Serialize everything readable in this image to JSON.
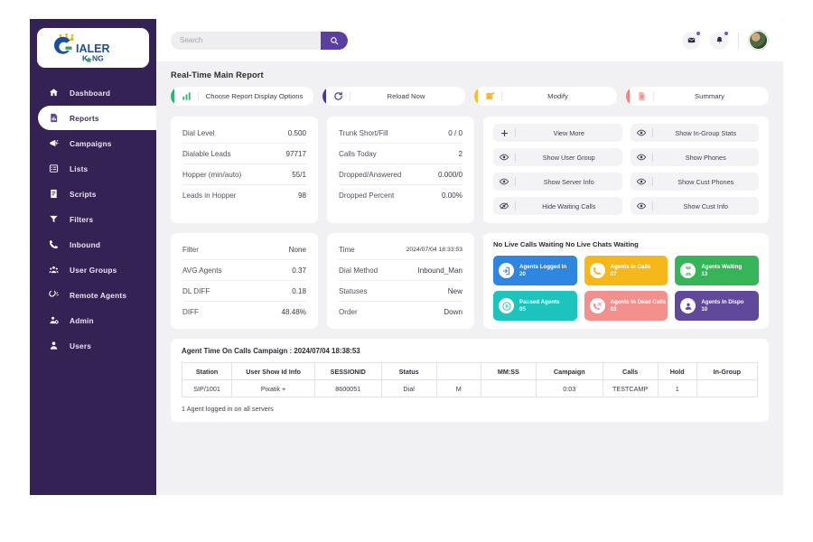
{
  "brand": {
    "name_main": "IALER",
    "name_sub": "K NG",
    "full": "DIALER KING"
  },
  "sidebar": {
    "items": [
      {
        "label": "Dashboard",
        "icon": "home-icon",
        "active": false
      },
      {
        "label": "Reports",
        "icon": "report-document-icon",
        "active": true
      },
      {
        "label": "Campaigns",
        "icon": "megaphone-icon",
        "active": false
      },
      {
        "label": "Lists",
        "icon": "list-icon",
        "active": false
      },
      {
        "label": "Scripts",
        "icon": "script-icon",
        "active": false
      },
      {
        "label": "Filters",
        "icon": "funnel-icon",
        "active": false
      },
      {
        "label": "Inbound",
        "icon": "phone-icon",
        "active": false
      },
      {
        "label": "User Groups",
        "icon": "users-group-icon",
        "active": false
      },
      {
        "label": "Remote Agents",
        "icon": "remote-agent-icon",
        "active": false
      },
      {
        "label": "Admin",
        "icon": "admin-gear-user-icon",
        "active": false
      },
      {
        "label": "Users",
        "icon": "user-icon",
        "active": false
      }
    ]
  },
  "topbar": {
    "search_placeholder": "Search",
    "search_value": "",
    "search_icon": "search-icon",
    "mail_icon": "mail-icon",
    "bell_icon": "bell-icon",
    "avatar": "user-avatar"
  },
  "page": {
    "title": "Real-Time Main Report"
  },
  "action_bar": [
    {
      "label": "Choose Report Display Options",
      "icon": "bar-chart-icon",
      "color": "#2bb673"
    },
    {
      "label": "Reload Now",
      "icon": "refresh-icon",
      "color": "#4b3a8f"
    },
    {
      "label": "Modify",
      "icon": "edit-pencil-icon",
      "color": "#f5c022"
    },
    {
      "label": "Summary",
      "icon": "document-icon",
      "color": "#f4817e"
    }
  ],
  "stats_left": [
    {
      "key": "Dial Level",
      "value": "0.500"
    },
    {
      "key": "Dialable Leads",
      "value": "97717"
    },
    {
      "key": "Hopper (min/auto)",
      "value": "55/1"
    },
    {
      "key": "Leads in Hopper",
      "value": "98"
    }
  ],
  "stats_mid": [
    {
      "key": "Trunk Short/Fill",
      "value": "0 / 0"
    },
    {
      "key": "Calls Today",
      "value": "2"
    },
    {
      "key": "Dropped/Answered",
      "value": "0.000/0"
    },
    {
      "key": "Dropped Percent",
      "value": "0.00%"
    }
  ],
  "stats_left2": [
    {
      "key": "Filter",
      "value": "None"
    },
    {
      "key": "AVG Agents",
      "value": "0.37"
    },
    {
      "key": "DL DIFF",
      "value": "0.18"
    },
    {
      "key": "DIFF",
      "value": "48.48%"
    }
  ],
  "stats_mid2": [
    {
      "key": "Time",
      "value": "2024/07/04 18:33:53",
      "small": true
    },
    {
      "key": "Dial Method",
      "value": "Inbound_Man"
    },
    {
      "key": "Statuses",
      "value": "New"
    },
    {
      "key": "Order",
      "value": "Down"
    }
  ],
  "toggles": [
    {
      "label": "View More",
      "icon": "plus-icon"
    },
    {
      "label": "Show In-Group Stats",
      "icon": "eye-icon"
    },
    {
      "label": "Show User Group",
      "icon": "eye-icon"
    },
    {
      "label": "Show Phones",
      "icon": "eye-icon"
    },
    {
      "label": "Show Server Info",
      "icon": "eye-icon"
    },
    {
      "label": "Show Cust Phones",
      "icon": "eye-icon"
    },
    {
      "label": "Hide Waiting Calls",
      "icon": "eye-off-icon"
    },
    {
      "label": "Show Cust Info",
      "icon": "eye-icon"
    }
  ],
  "agents": {
    "heading": "No Live Calls Waiting No Live Chats Waiting",
    "cards": [
      {
        "title": "Agents Logged In",
        "count": "20",
        "color": "#2f86e0",
        "icon": "agent-login-icon"
      },
      {
        "title": "Agents In Calls",
        "count": "07",
        "color": "#f5b818",
        "icon": "phone-call-icon"
      },
      {
        "title": "Agents Waiting",
        "count": "13",
        "color": "#35b558",
        "icon": "hourglass-icon"
      },
      {
        "title": "Paused Agents",
        "count": "05",
        "color": "#1dc4bd",
        "icon": "pause-icon"
      },
      {
        "title": "Agents In Dead Calls",
        "count": "02",
        "color": "#f2908e",
        "icon": "phone-missed-icon"
      },
      {
        "title": "Agents In Dispo",
        "count": "10",
        "color": "#60499b",
        "icon": "person-badge-icon"
      }
    ]
  },
  "table": {
    "title": "Agent Time On Calls Campaign : 2024/07/04 18:38:53",
    "headers": [
      "Station",
      "User Show Id Info",
      "SESSIONID",
      "Status",
      "",
      "MM:SS",
      "Campaign",
      "Calls",
      "Hold",
      "In-Group"
    ],
    "rows": [
      [
        "SIP/1001",
        "Pixatik +",
        "8600051",
        "Dial",
        "M",
        "",
        "0:03",
        "TESTCAMP",
        "1",
        ""
      ]
    ],
    "footer": "1 Agent logged in on all servers"
  }
}
